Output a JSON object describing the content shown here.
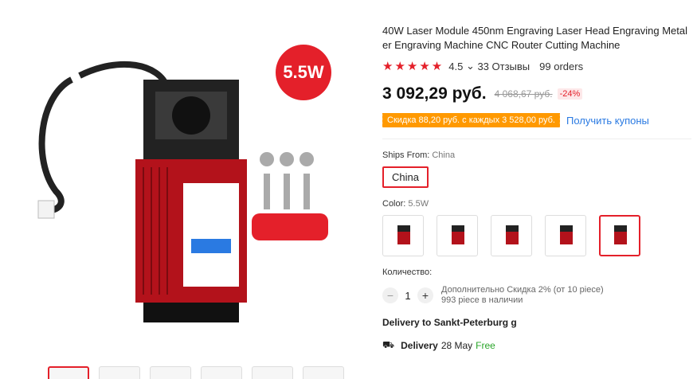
{
  "product": {
    "badge": "5.5W",
    "title": "40W Laser Module 450nm Engraving Laser Head Engraving Metal er Engraving Machine CNC Router Cutting Machine",
    "rating": "4.5",
    "reviews": "33 Отзывы",
    "orders": "99 orders",
    "price": "3 092,29 руб.",
    "old_price": "4 068,67 руб.",
    "discount": "-24%",
    "coupon_text": "Скидка 88,20 руб. с каждых 3 528,00 руб.",
    "coupon_link": "Получить купоны"
  },
  "shipping": {
    "label": "Ships From:",
    "value": "China",
    "option": "China"
  },
  "color": {
    "label": "Color:",
    "value": "5.5W",
    "options": [
      "opt1",
      "opt2",
      "opt3",
      "opt4",
      "opt5"
    ]
  },
  "quantity": {
    "label": "Количество:",
    "value": "1",
    "note1": "Дополнительно Скидка 2% (от 10 piece)",
    "note2": "993 piece в наличии"
  },
  "delivery": {
    "title": "Delivery to Sankt-Peterburg g",
    "label": "Delivery",
    "date": "28 May",
    "free": "Free"
  },
  "colors": {
    "accent": "#e4202a",
    "coupon": "#ff9900",
    "link": "#2a7ae2"
  }
}
